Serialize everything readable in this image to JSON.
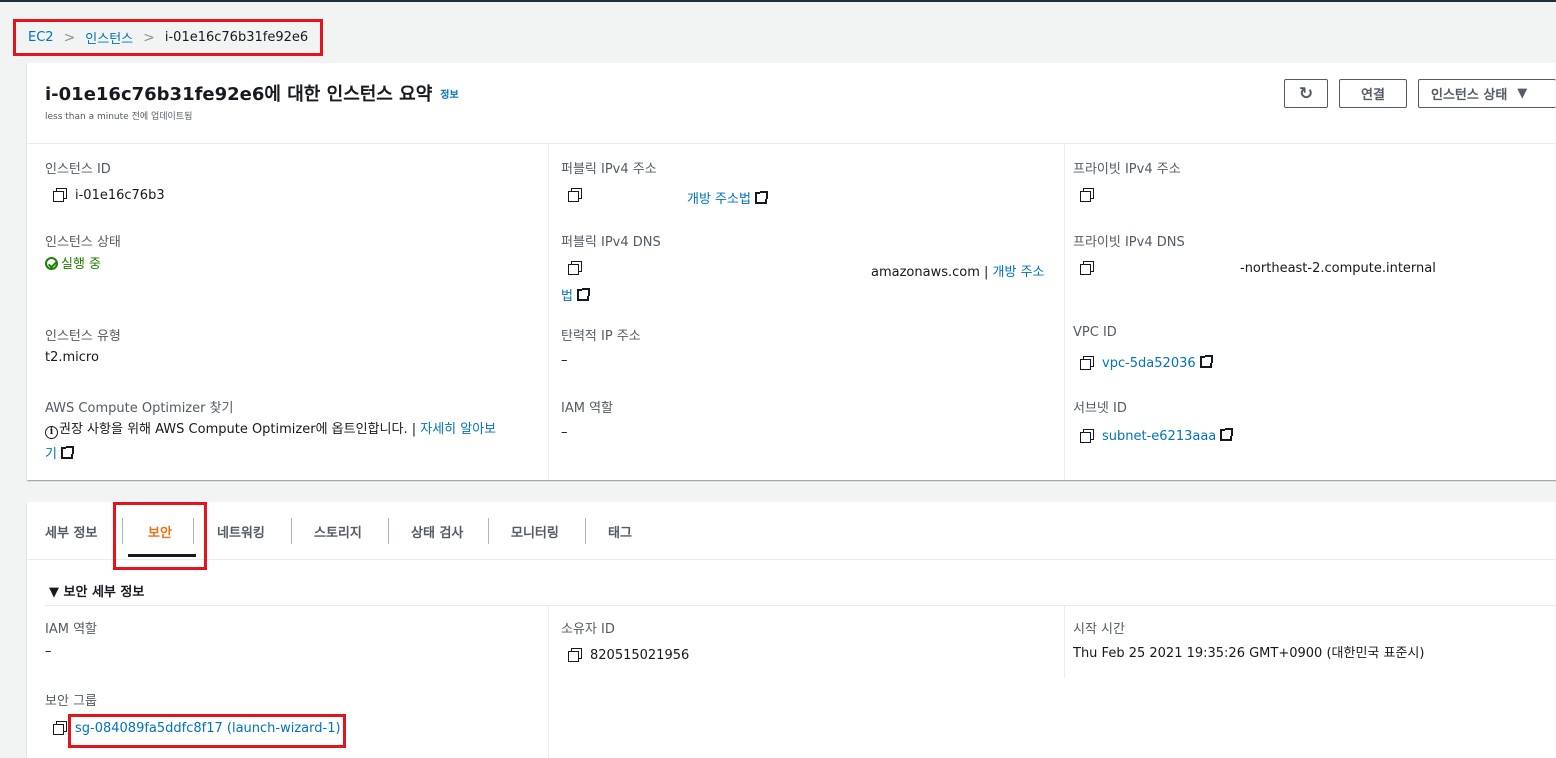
{
  "breadcrumb": {
    "root": "EC2",
    "section": "인스턴스",
    "current": "i-01e16c76b31fe92e6"
  },
  "summary": {
    "title": "i-01e16c76b31fe92e6에 대한 인스턴스 요약",
    "info_link": "정보",
    "subtitle": "less than a minute 전에 업데이트됨",
    "buttons": {
      "refresh_glyph": "↻",
      "connect": "연결",
      "instance_state": "인스턴스 상태",
      "instance_state_caret": "▼"
    },
    "fields": {
      "instance_id_label": "인스턴스 ID",
      "instance_id_value": "i-01e16c76b3",
      "public_ipv4_label": "퍼블릭 IPv4 주소",
      "public_ipv4_link": "개방 주소법",
      "private_ipv4_label": "프라이빗 IPv4 주소",
      "instance_state_label": "인스턴스 상태",
      "instance_state_value": "실행 중",
      "public_dns_label": "퍼블릭 IPv4 DNS",
      "public_dns_value": "amazonaws.com |",
      "public_dns_link_1": "개방 주소",
      "public_dns_link_2": "법",
      "private_dns_label": "프라이빗 IPv4 DNS",
      "private_dns_value": "-northeast-2.compute.internal",
      "instance_type_label": "인스턴스 유형",
      "instance_type_value": "t2.micro",
      "elastic_ip_label": "탄력적 IP 주소",
      "elastic_ip_value": "–",
      "vpc_label": "VPC ID",
      "vpc_value": "vpc-5da52036",
      "optimizer_label": "AWS Compute Optimizer 찾기",
      "optimizer_text": "권장 사항을 위해 AWS Compute Optimizer에 옵트인합니다. |",
      "optimizer_link_1": "자세히 알아보",
      "optimizer_link_2": "기",
      "iam_label": "IAM 역할",
      "iam_value": "–",
      "subnet_label": "서브넷 ID",
      "subnet_value": "subnet-e6213aaa"
    }
  },
  "tabs": [
    "세부 정보",
    "보안",
    "네트워킹",
    "스토리지",
    "상태 검사",
    "모니터링",
    "태그"
  ],
  "security": {
    "section_title": "▼ 보안 세부 정보",
    "iam_label": "IAM 역할",
    "iam_value": "–",
    "owner_label": "소유자 ID",
    "owner_value": "820515021956",
    "launch_label": "시작 시간",
    "launch_value": "Thu Feb 25 2021 19:35:26 GMT+0900 (대한민국 표준시)",
    "sg_label": "보안 그룹",
    "sg_value": "sg-084089fa5ddfc8f17 (launch-wizard-1)"
  },
  "colors": {
    "link": "#0073bb",
    "active_tab": "#ec7211",
    "status_ok": "#1d8102",
    "highlight": "#e3141c"
  }
}
